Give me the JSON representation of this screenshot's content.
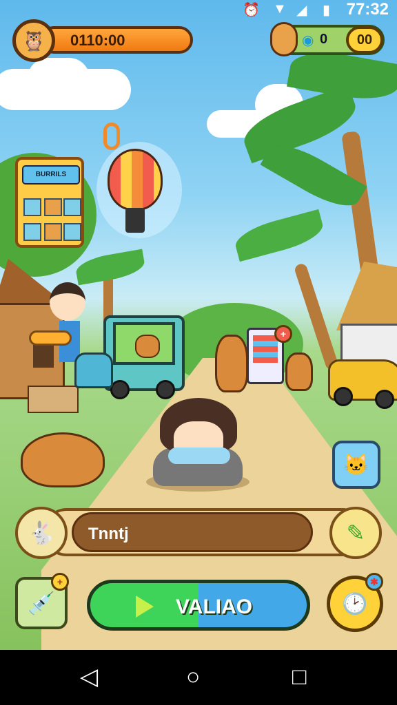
{
  "status_bar": {
    "time": "77:32",
    "icons": [
      "alarm-icon",
      "wifi-icon",
      "signal-icon",
      "battery-icon"
    ]
  },
  "currency": {
    "coins": "0110:00"
  },
  "top_right": {
    "gems": "0",
    "gold": "00"
  },
  "billboard": {
    "title": "BURRILS"
  },
  "name_bar": {
    "value": "Tnntj"
  },
  "actions": {
    "play_label": "VALIAO"
  },
  "navigation": {
    "items": [
      "back",
      "home",
      "recents"
    ]
  },
  "colors": {
    "sky": "#5fb9ec",
    "grass": "#86c25d",
    "play_green": "#3ed45a",
    "play_blue": "#42a8e8",
    "coin_orange": "#f07a12"
  }
}
